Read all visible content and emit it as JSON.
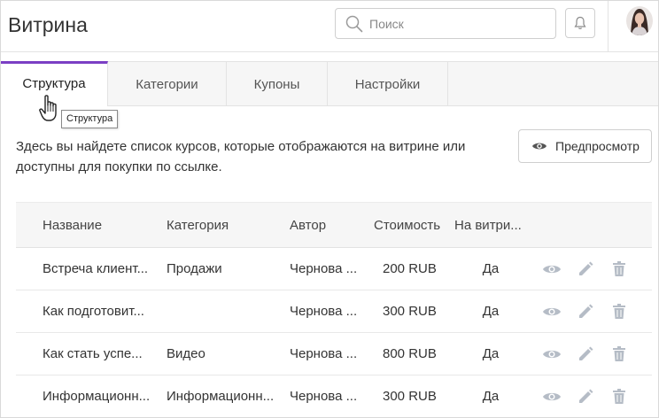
{
  "header": {
    "title": "Витрина",
    "search_placeholder": "Поиск"
  },
  "tabs": [
    {
      "label": "Структура",
      "active": true
    },
    {
      "label": "Категории",
      "active": false
    },
    {
      "label": "Купоны",
      "active": false
    },
    {
      "label": "Настройки",
      "active": false
    }
  ],
  "tooltip": "Структура",
  "description": "Здесь вы найдете список курсов, которые отображаются на витрине или доступны для покупки по ссылке.",
  "preview_button": "Предпросмотр",
  "table": {
    "columns": [
      "Название",
      "Категория",
      "Автор",
      "Стоимость",
      "На витри..."
    ],
    "rows": [
      {
        "name": "Встреча клиент...",
        "category": "Продажи",
        "author": "Чернова ...",
        "price": "200 RUB",
        "showcase": "Да"
      },
      {
        "name": "Как подготовит...",
        "category": "",
        "author": "Чернова ...",
        "price": "300 RUB",
        "showcase": "Да"
      },
      {
        "name": "Как стать успе...",
        "category": "Видео",
        "author": "Чернова ...",
        "price": "800 RUB",
        "showcase": "Да"
      },
      {
        "name": "Информационн...",
        "category": "Информационн...",
        "author": "Чернова ...",
        "price": "300 RUB",
        "showcase": "Да"
      }
    ]
  },
  "colors": {
    "accent": "#7b3fc4",
    "icon_gray": "#b5bcc6"
  }
}
